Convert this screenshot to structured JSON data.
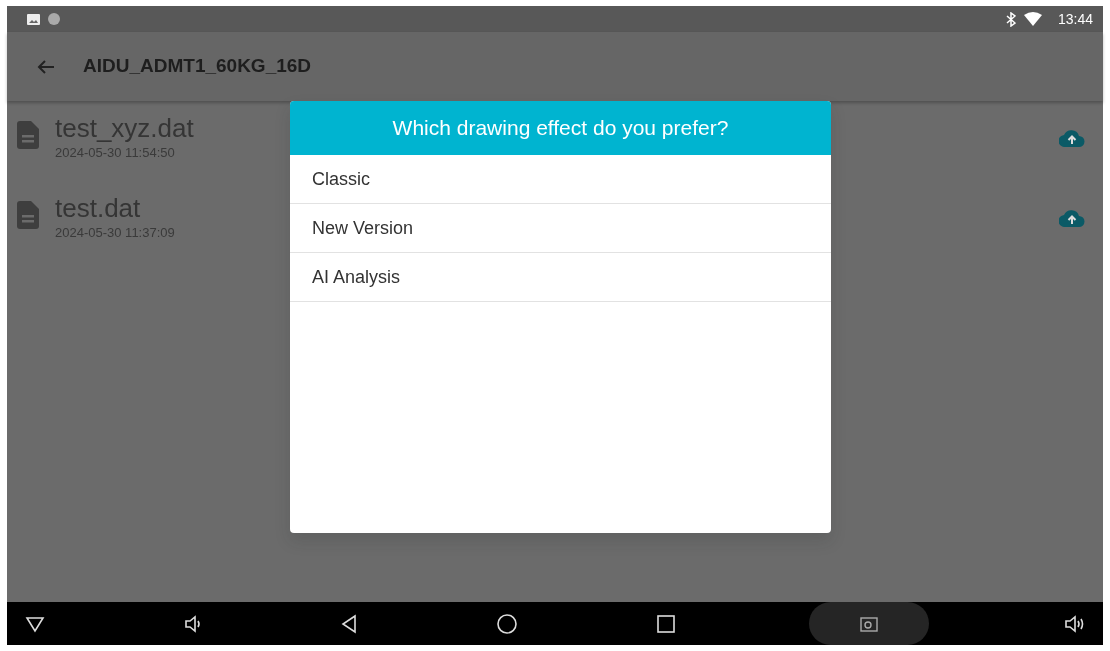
{
  "status_bar": {
    "time": "13:44"
  },
  "app_bar": {
    "title": "AIDU_ADMT1_60KG_16D"
  },
  "files": [
    {
      "name": "test_xyz.dat",
      "date": "2024-05-30 11:54:50"
    },
    {
      "name": "test.dat",
      "date": "2024-05-30 11:37:09"
    }
  ],
  "dialog": {
    "title": "Which drawing effect do you prefer?",
    "options": [
      "Classic",
      "New Version",
      "AI Analysis"
    ]
  }
}
